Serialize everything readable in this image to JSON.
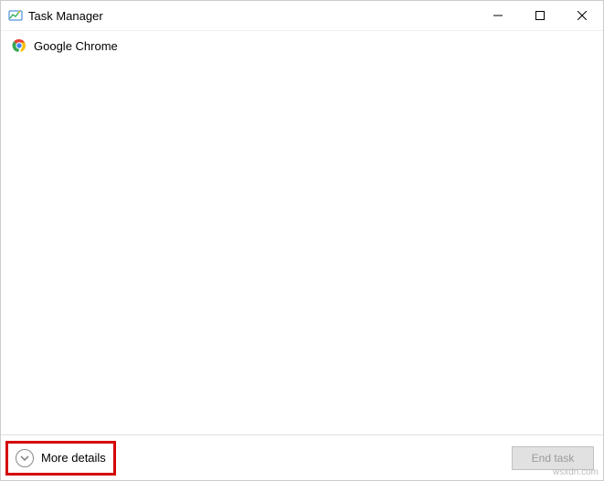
{
  "titlebar": {
    "title": "Task Manager"
  },
  "tasks": {
    "items": [
      {
        "label": "Google Chrome"
      }
    ]
  },
  "footer": {
    "more_details_label": "More details",
    "end_task_label": "End task"
  },
  "watermark": "wsxdn.com"
}
